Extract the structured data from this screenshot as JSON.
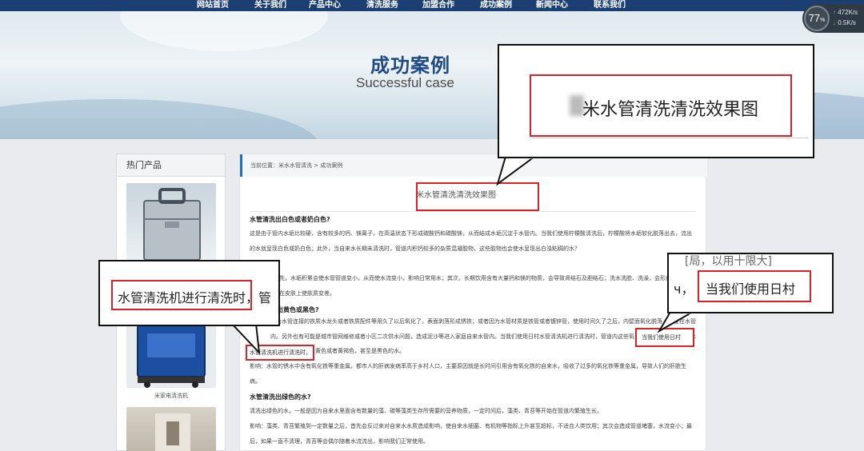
{
  "nav": {
    "items": [
      "网站首页",
      "关于我们",
      "产品中心",
      "清洗服务",
      "加盟合作",
      "成功案例",
      "新闻中心",
      "联系我们"
    ]
  },
  "banner": {
    "title": "成功案例",
    "subtitle": "Successful case"
  },
  "speed_widget": {
    "percent": "77",
    "unit": "%",
    "upload": "472K/s",
    "download": "0.5K/s"
  },
  "sidebar": {
    "heading": "热门产品",
    "product_caption": "米家电清洗机"
  },
  "breadcrumb": {
    "text": "当前位置：米水水管清洗 > 成功案例"
  },
  "article": {
    "title": "米水管清洗清洗效果图",
    "q1": "水管清洗出白色或者奶白色?",
    "p1": "这是由于管内水垢比较硬，含有较多的钙、镁离子，在高温状态下形成碳酸钙和碳酸镁，从而结成水垢沉淀于水管内。当我们使用柠檬酸清洗后，柠檬酸将水垢软化脱落出去，流出的水就呈现白色或奶白色；此外，当自来水长期未清洗时，管道内积钙较多的杂质混凝胶物，这些胶物也会使水呈现出白浊粘稠的水？",
    "p2": "首先，水垢积累会使水管管道变小，从而使水流变小，影响日常用水；其次，长期饮用含有大量钙和镁的物质，会导致肾结石及胆结石；洗水洗脸、洗澡，会形成钙镁皂，黏在皮肤上使肤质变差。",
    "q2": "出黄色或黑色?",
    "p3": "因为水管连接的铁质水龙头或者铁质配件等用久了以后氧化了，表面剥落形成锈铁；或者因为水管材质是铁管或者镀锌管，使用时间久了之后，内壁面氧化脱落，沉淀在水管内。另外也有可能是城市管网维修或者小区二次供水问题，造成泥沙等进入家庭自来水管内。当我们使用日村水管清洗机进行清洗时，管道内这些氧化杂质溶解或者冲走在水里排出，就形成了黄色或者黄褐色，甚至是黑色的水。",
    "p4": "影响：水管的锈水中含有氧化铁等重金属，都市人的肝病发病率高于乡村人口，主要原因就是长时间引用含有氧化铁的自来水，吸收了过多的氧化铁等重金属，导致人们的肝脏生病。",
    "q3": "水管清洗出绿色的水?",
    "p5": "清洗出绿色的水，一般是因为自来水里面含有数量的藻、碳等藻类生存所需要的营养物质，一定时间后，藻类、青苔等开始在管道内繁殖生长。",
    "p6": "影响：藻类、青苔繁殖到一定数量之后，首先会反过来对自来水水质造成影响，使自来水细菌、有机物等指标上升甚至超标，不适合人类饮用；其次会造成管道堵塞，水流变小；最后，如果一直不清理，青苔等会偶尔随着水流流出，影响我们正常使用。"
  },
  "callouts": {
    "top": "米水管清洗清洗效果图",
    "left": "水管清洗机进行清洗时，管",
    "right_top": "[局，以用十限大]",
    "right": "当我们使用日村",
    "right_prefix": "ч，"
  },
  "highlights": {
    "inline_right": "当我们使用日村",
    "inline_left": "水管清洗机进行清洗时，"
  }
}
